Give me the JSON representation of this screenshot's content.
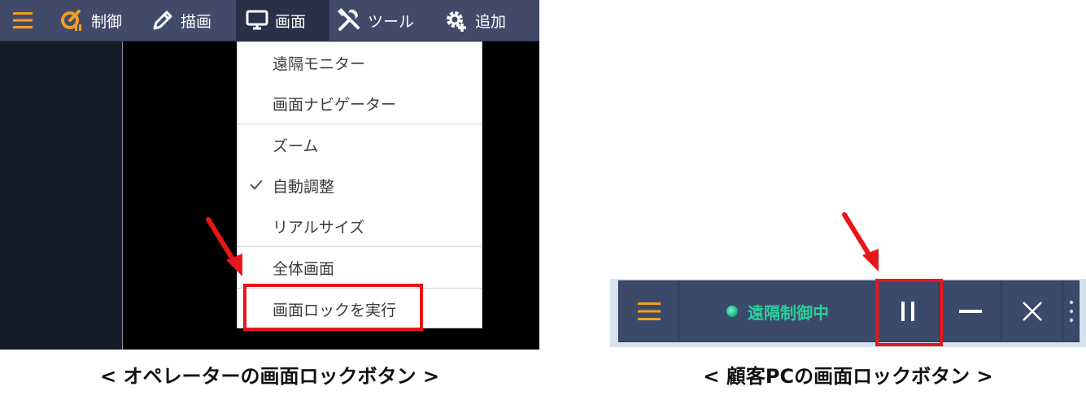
{
  "operator_toolbar": {
    "menu_icon": "hamburger-icon",
    "items": [
      {
        "label": "制御",
        "icon": "control-icon"
      },
      {
        "label": "描画",
        "icon": "pencil-icon"
      },
      {
        "label": "画面",
        "icon": "monitor-icon"
      },
      {
        "label": "ツール",
        "icon": "tools-icon"
      },
      {
        "label": "追加",
        "icon": "gear-plus-icon"
      }
    ]
  },
  "screen_menu": {
    "items": [
      {
        "label": "遠隔モニター",
        "checked": false
      },
      {
        "label": "画面ナビゲーター",
        "checked": false
      },
      {
        "label": "ズーム",
        "checked": false
      },
      {
        "label": "自動調整",
        "checked": true
      },
      {
        "label": "リアルサイズ",
        "checked": false
      },
      {
        "label": "全体画面",
        "checked": false
      },
      {
        "label": "画面ロックを実行",
        "checked": false
      }
    ]
  },
  "customer_bar": {
    "status_text": "遠隔制御中",
    "menu_icon": "hamburger-icon",
    "pause_icon": "pause-icon",
    "minimize_icon": "minimize-icon",
    "close_icon": "close-icon"
  },
  "captions": {
    "left": "< オペレーターの画面ロックボタン >",
    "right": "< 顧客PCの画面ロックボタン >"
  },
  "colors": {
    "toolbar_bg": "#424a6a",
    "accent_orange": "#f0a020",
    "highlight_red": "#e8151b",
    "status_green": "#2ecf9a",
    "customer_bar_bg": "#3b4a6b"
  }
}
